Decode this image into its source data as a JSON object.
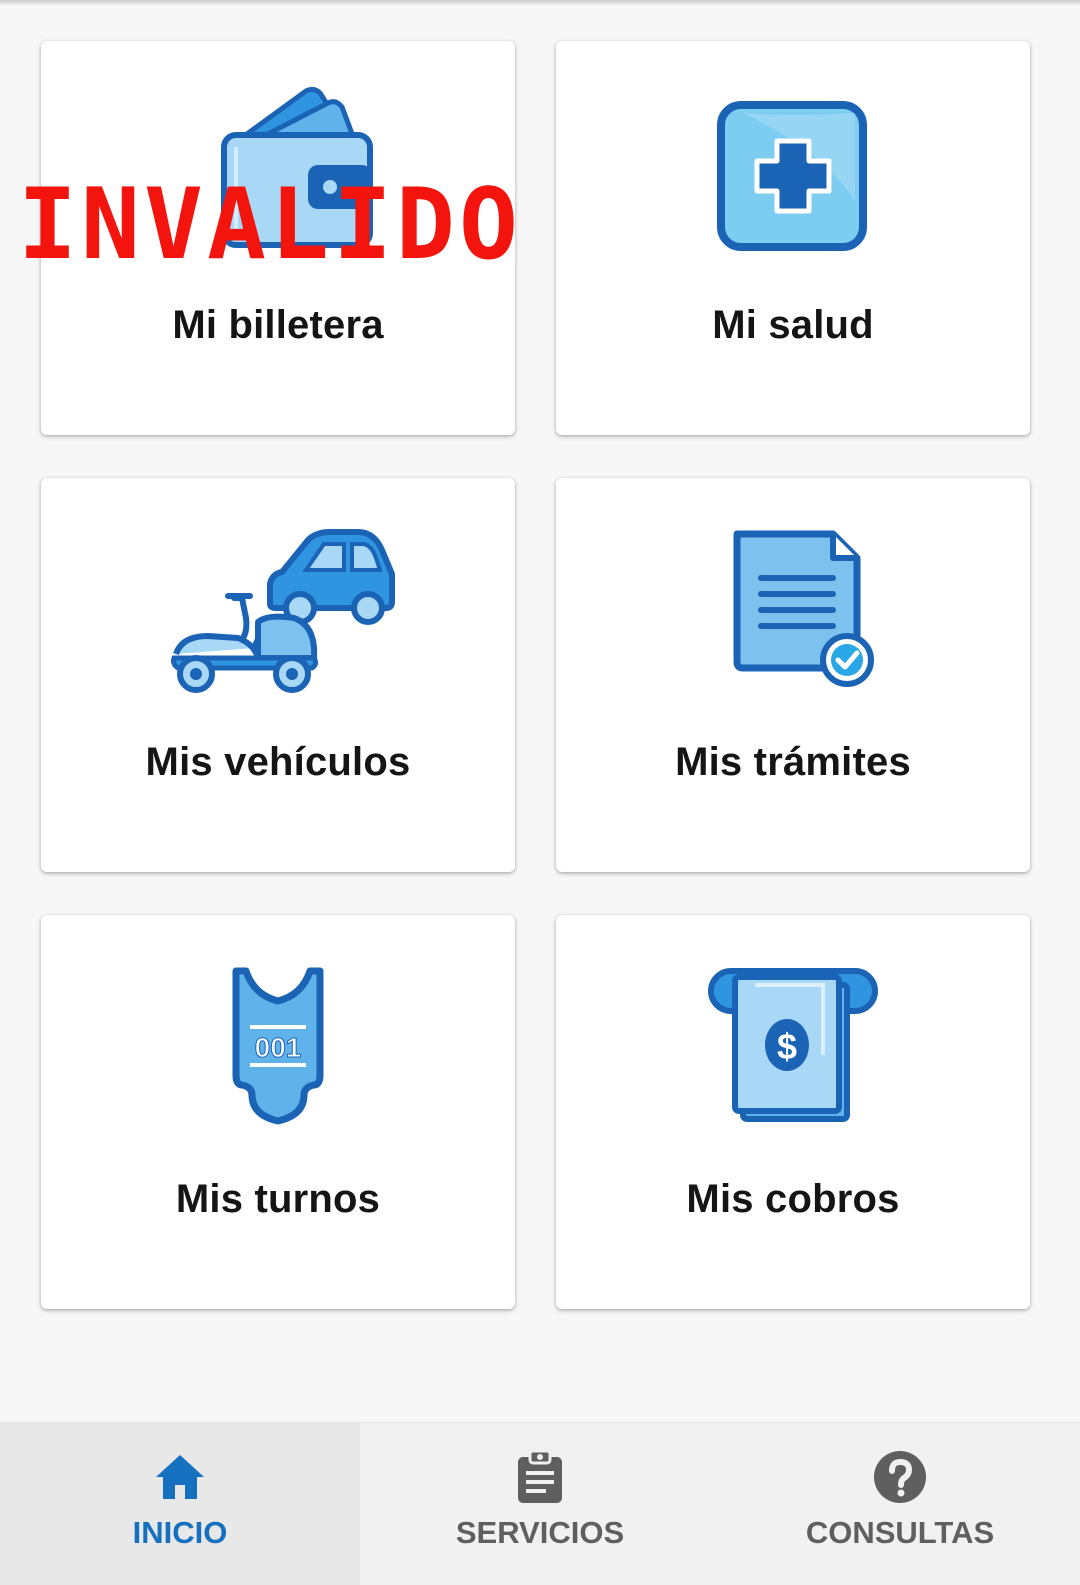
{
  "colors": {
    "accent": "#1570bf",
    "icon_dark": "#1a63b5",
    "icon_mid": "#2f95e0",
    "icon_light": "#a8d8f5",
    "nav_inactive": "#5f5f5f",
    "stamp": "#f2140d"
  },
  "stamp_text": "INVALIDO",
  "cards": [
    {
      "label": "Mi billetera",
      "icon": "wallet-icon"
    },
    {
      "label": "Mi salud",
      "icon": "health-cross-icon"
    },
    {
      "label": "Mis vehículos",
      "icon": "vehicles-icon"
    },
    {
      "label": "Mis trámites",
      "icon": "document-check-icon"
    },
    {
      "label": "Mis turnos",
      "icon": "ticket-icon"
    },
    {
      "label": "Mis cobros",
      "icon": "payment-icon"
    }
  ],
  "bottom_nav": {
    "active": "INICIO",
    "items": [
      {
        "label": "INICIO",
        "icon": "home-icon"
      },
      {
        "label": "SERVICIOS",
        "icon": "clipboard-icon"
      },
      {
        "label": "CONSULTAS",
        "icon": "help-icon"
      }
    ]
  },
  "ticket_number": "001",
  "currency_symbol": "$"
}
